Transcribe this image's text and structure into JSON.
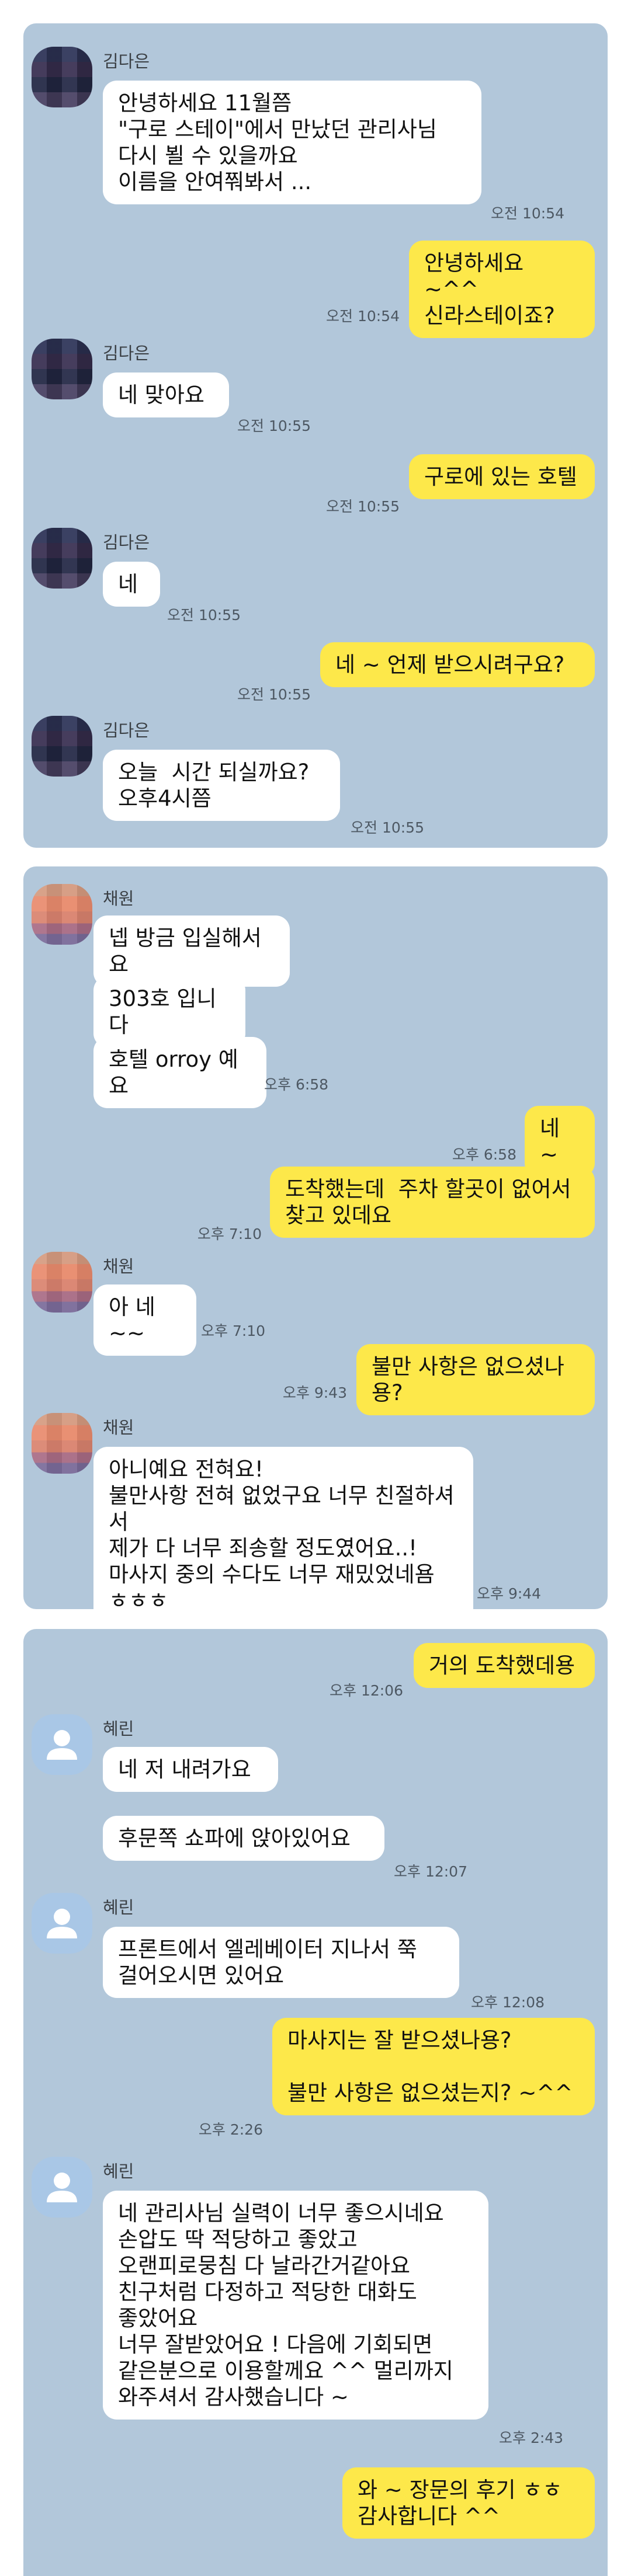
{
  "colors": {
    "chat_background": "#b2c7da",
    "incoming_bubble": "#ffffff",
    "outgoing_bubble": "#fde84a",
    "default_avatar": "#a9c7e6"
  },
  "chats": [
    {
      "messages": [
        {
          "sender": "김다은",
          "text": "안녕하세요 11월쯤\n\"구로 스테이\"에서 만났던 관리사님\n다시 뵐 수 있을까요\n이름을 안여쭤봐서 ...",
          "time": "오전 10:54"
        },
        {
          "text": "안녕하세요 ~^^\n신라스테이죠?",
          "time": "오전 10:54"
        },
        {
          "sender": "김다은",
          "text": "네 맞아요",
          "time": "오전 10:55"
        },
        {
          "text": "구로에 있는 호텔",
          "time": "오전 10:55"
        },
        {
          "sender": "김다은",
          "text": "네",
          "time": "오전 10:55"
        },
        {
          "text": "네 ~ 언제 받으시려구요?",
          "time": "오전 10:55"
        },
        {
          "sender": "김다은",
          "text": "오늘  시간 되실까요?\n오후4시쯤",
          "time": "오전 10:55"
        }
      ]
    },
    {
      "messages": [
        {
          "sender": "채원",
          "text": "넵 방금 입실해서요"
        },
        {
          "text": "303호 입니다"
        },
        {
          "text": "호텔 orroy 예요",
          "time": "오후 6:58"
        },
        {
          "text": "네 ~",
          "time": "오후 6:58"
        },
        {
          "text": "도착했는데  주차 할곳이 없어서\n찾고 있데요",
          "time": "오후 7:10"
        },
        {
          "sender": "채원",
          "text": "아 네~~",
          "time": "오후 7:10"
        },
        {
          "text": "불만 사항은 없으셨나용?",
          "time": "오후 9:43"
        },
        {
          "sender": "채원",
          "text": "아니예요 전혀요!\n불만사항 전혀 없었구요 너무 친절하셔서\n제가 다 너무 죄송할 정도였어요..!\n마사지 중의 수다도 너무 재밌었네욤\nㅎㅎㅎ",
          "time": "오후 9:44"
        }
      ]
    },
    {
      "messages": [
        {
          "text": "거의 도착했데용",
          "time": "오후 12:06"
        },
        {
          "sender": "혜린",
          "text": "네 저 내려가요"
        },
        {
          "text": "후문쪽 쇼파에 앉아있어요",
          "time": "오후 12:07"
        },
        {
          "sender": "혜린",
          "text": "프론트에서 엘레베이터 지나서 쭉\n걸어오시면 있어요",
          "time": "오후 12:08"
        },
        {
          "text": "마사지는 잘 받으셨나용?\n\n불만 사항은 없으셨는지? ~^^",
          "time": "오후 2:26"
        },
        {
          "sender": "혜린",
          "text": "네 관리사님 실력이 너무 좋으시네요\n손압도 딱 적당하고 좋았고\n오랜피로뭉침 다 날라간거같아요\n친구처럼 다정하고 적당한 대화도\n좋았어요\n너무 잘받았어요 ! 다음에 기회되면\n같은분으로 이용할께요 ^^ 멀리까지\n와주셔서 감사했습니다 ~",
          "time": "오후 2:43"
        },
        {
          "text": "와 ~ 장문의 후기 ㅎㅎ\n감사합니다 ^^"
        }
      ]
    }
  ]
}
